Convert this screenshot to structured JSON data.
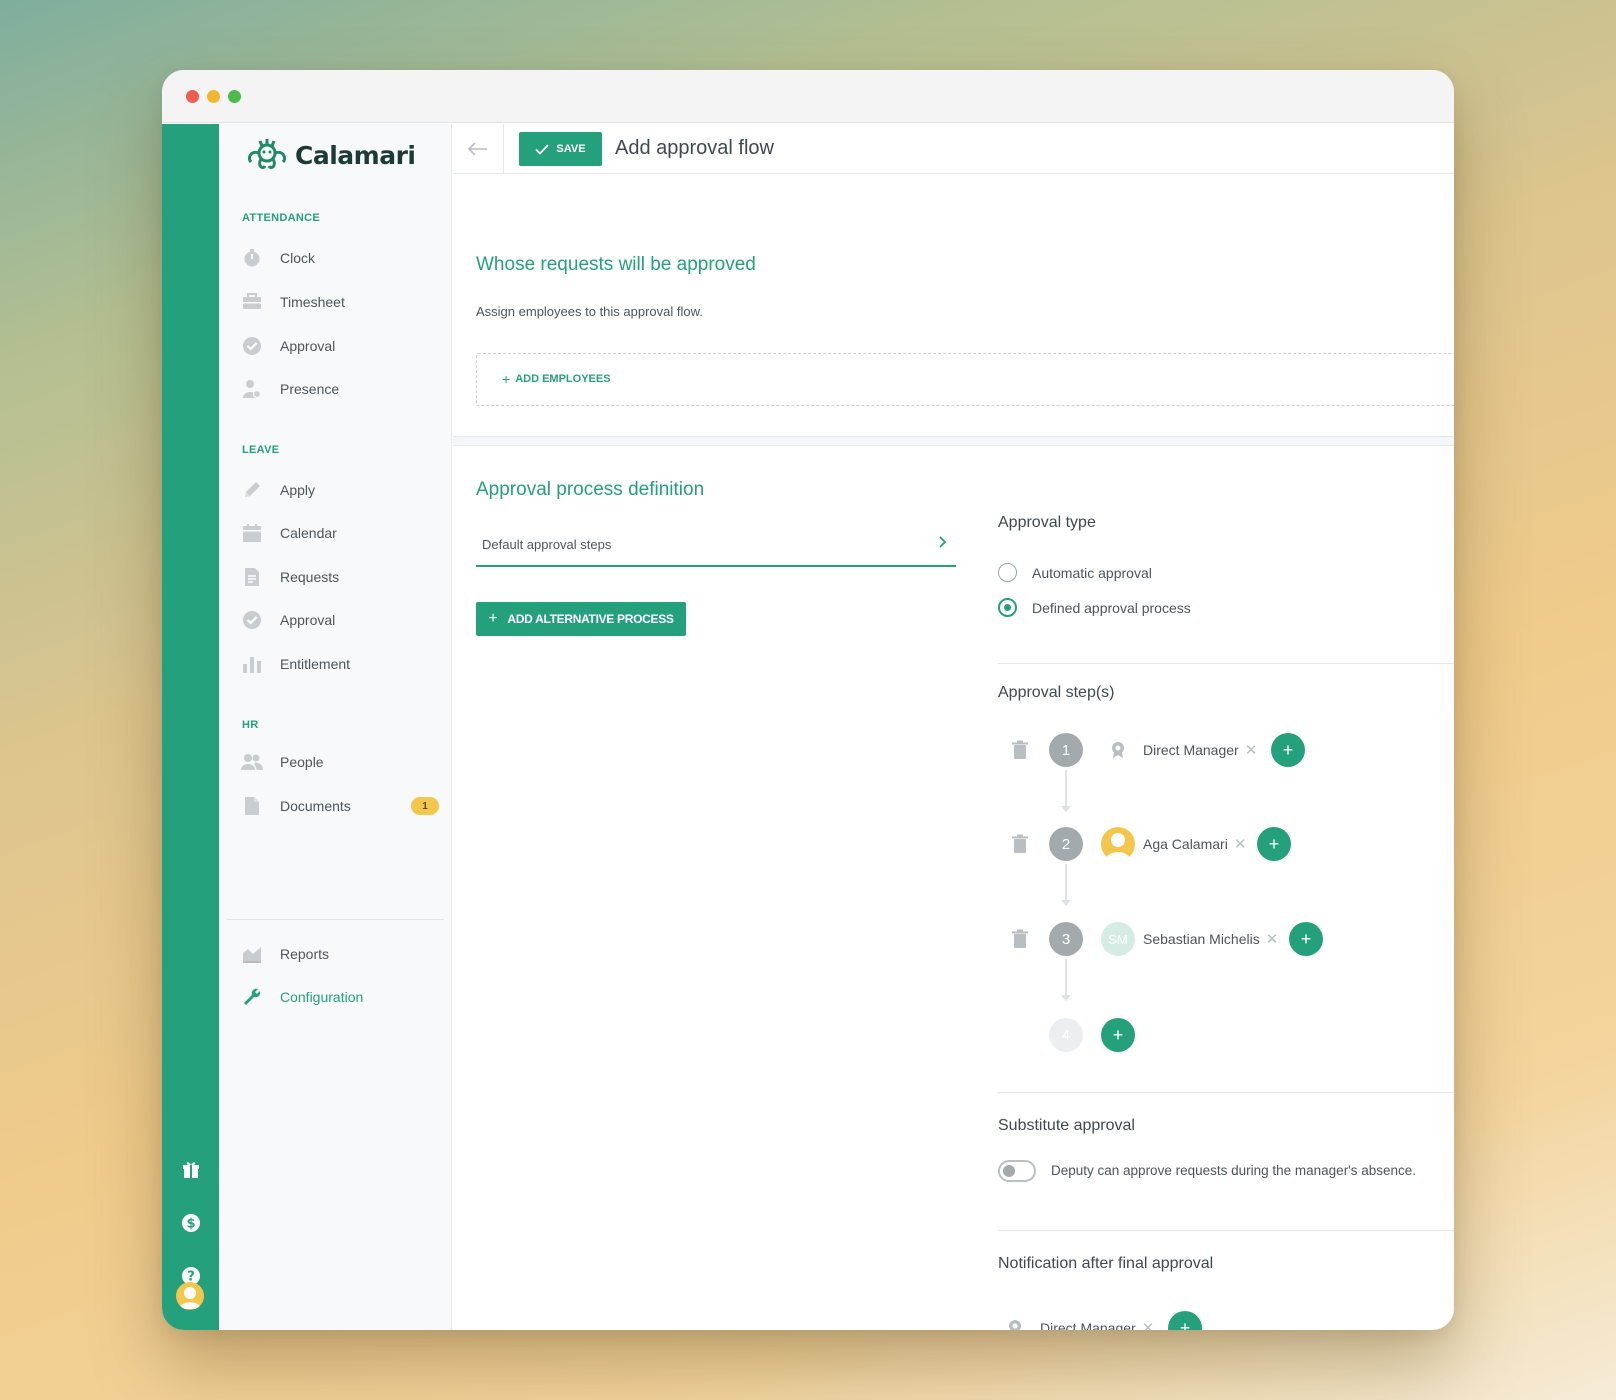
{
  "app": {
    "brand": "Calamari"
  },
  "colors": {
    "accent": "#25a07c",
    "badge": "#f3c64c"
  },
  "sidebar": {
    "sections": [
      {
        "label": "ATTENDANCE"
      },
      {
        "label": "LEAVE"
      },
      {
        "label": "HR"
      }
    ],
    "items": [
      {
        "label": "Clock",
        "icon": "stopwatch-icon"
      },
      {
        "label": "Timesheet",
        "icon": "timesheet-icon"
      },
      {
        "label": "Approval",
        "icon": "check-circle-icon"
      },
      {
        "label": "Presence",
        "icon": "person-presence-icon"
      },
      {
        "label": "Apply",
        "icon": "pencil-icon"
      },
      {
        "label": "Calendar",
        "icon": "calendar-icon"
      },
      {
        "label": "Requests",
        "icon": "document-icon"
      },
      {
        "label": "Approval",
        "icon": "check-circle-icon"
      },
      {
        "label": "Entitlement",
        "icon": "bar-chart-icon"
      },
      {
        "label": "People",
        "icon": "people-icon"
      },
      {
        "label": "Documents",
        "icon": "file-icon",
        "badge": "1"
      },
      {
        "label": "Reports",
        "icon": "reports-chart-icon"
      },
      {
        "label": "Configuration",
        "icon": "wrench-icon",
        "active": true
      }
    ]
  },
  "rail": {
    "icons": [
      "gift-icon",
      "billing-icon",
      "help-icon",
      "user-avatar"
    ]
  },
  "toolbar": {
    "save_label": "SAVE",
    "title": "Add approval flow"
  },
  "assign": {
    "heading": "Whose requests will be approved",
    "helper": "Assign employees to this approval flow.",
    "add_employees": "ADD EMPLOYEES"
  },
  "process": {
    "heading": "Approval process definition",
    "tab_label": "Default approval steps",
    "add_alternative": "ADD ALTERNATIVE PROCESS"
  },
  "approval_type": {
    "heading": "Approval type",
    "options": [
      {
        "label": "Automatic approval",
        "selected": false
      },
      {
        "label": "Defined approval process",
        "selected": true
      }
    ]
  },
  "steps": {
    "heading": "Approval step(s)",
    "items": [
      {
        "number": "1",
        "approver": "Direct Manager",
        "approver_type": "role"
      },
      {
        "number": "2",
        "approver": "Aga Calamari",
        "approver_type": "photo"
      },
      {
        "number": "3",
        "approver": "Sebastian Michelis",
        "approver_type": "initials",
        "initials": "SM"
      }
    ],
    "next_number": "4"
  },
  "substitute": {
    "heading": "Substitute approval",
    "toggle_label": "Deputy can approve requests during the manager's absence.",
    "enabled": false
  },
  "notification": {
    "heading": "Notification after final approval",
    "recipient": "Direct Manager"
  }
}
